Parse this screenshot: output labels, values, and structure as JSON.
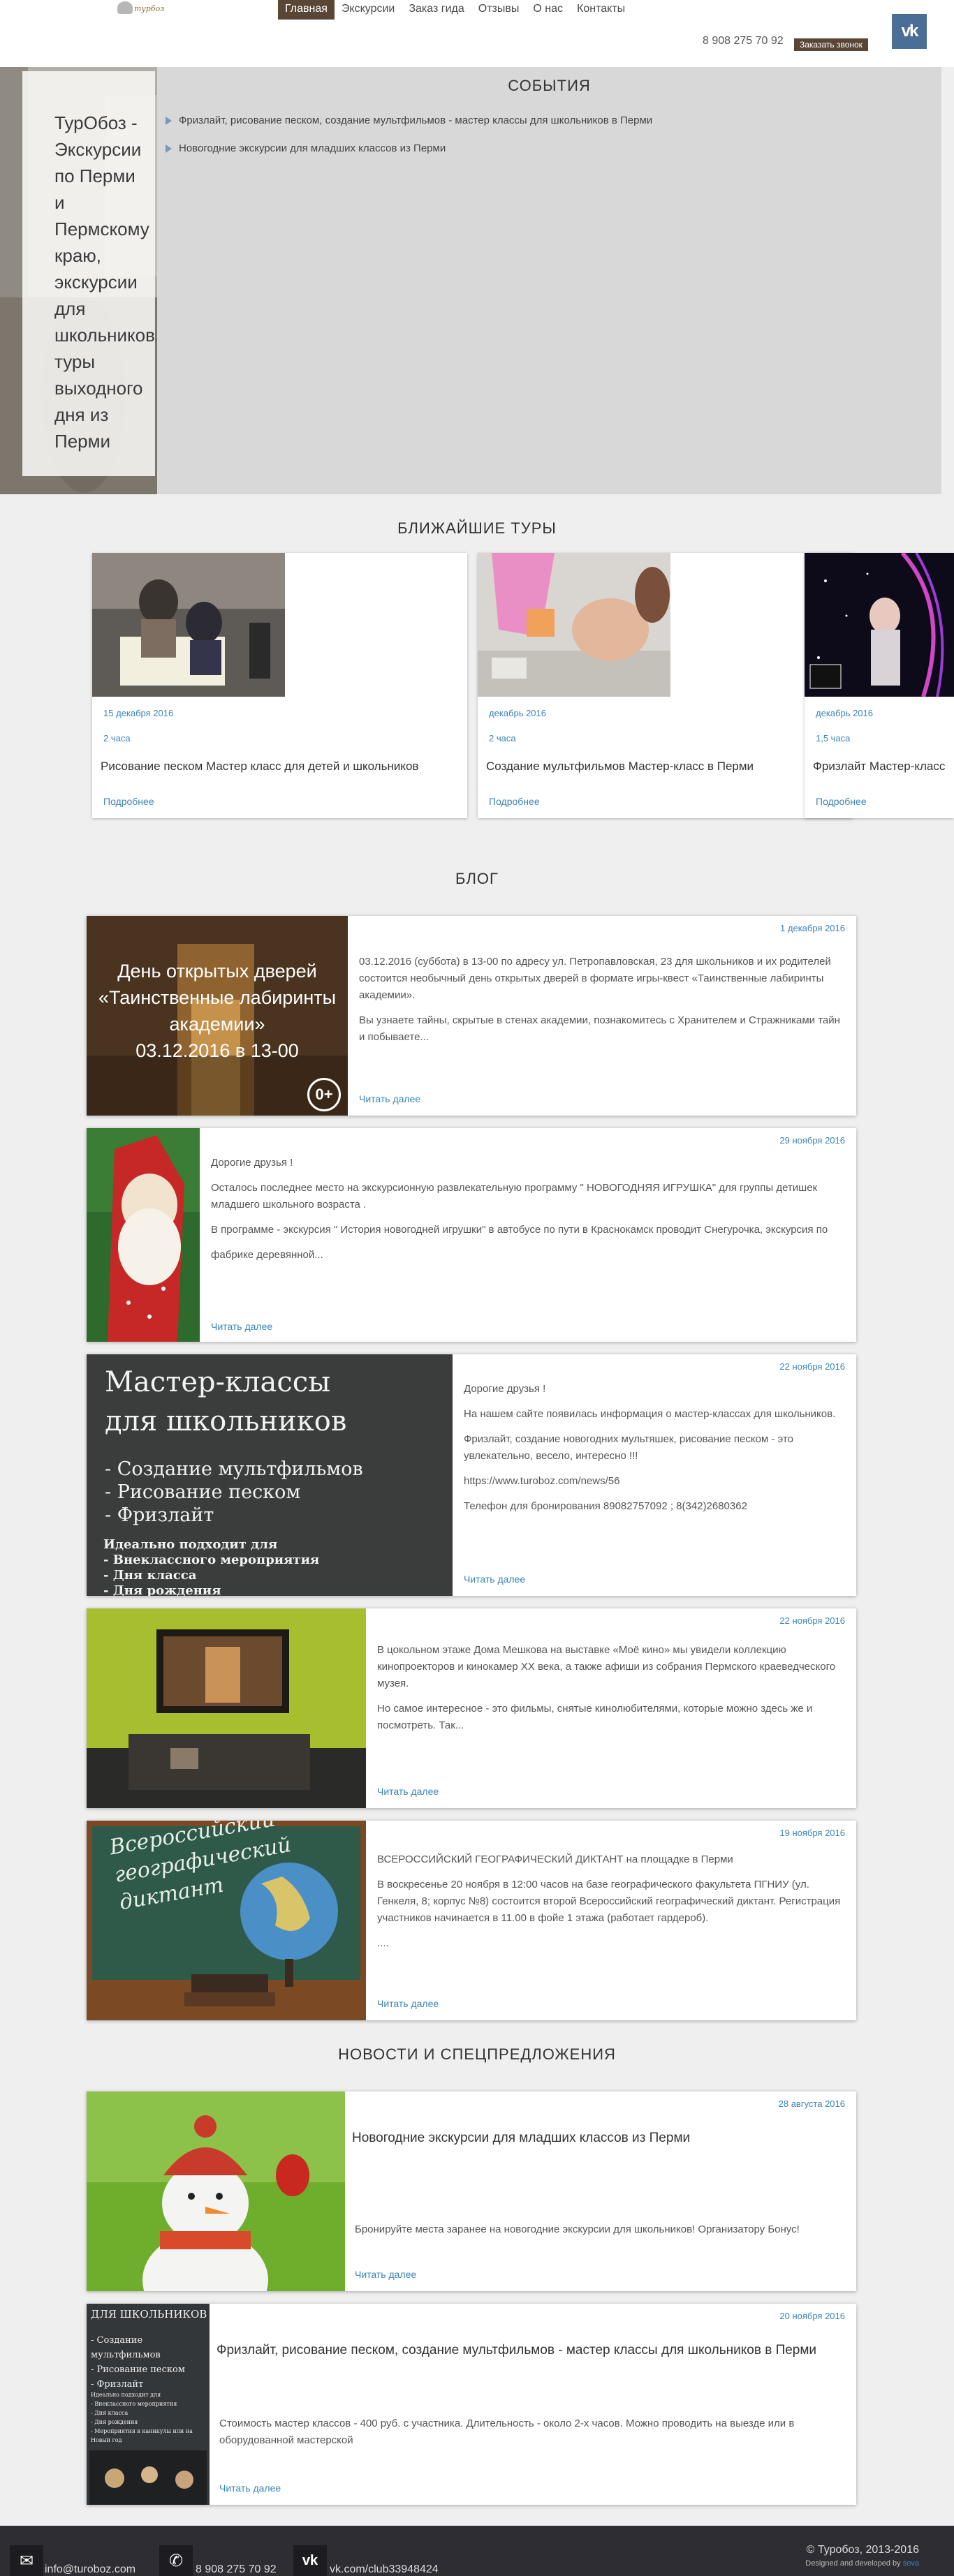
{
  "header": {
    "logo_text": "турбоз",
    "nav": [
      {
        "label": "Главная",
        "active": true
      },
      {
        "label": "Экскурсии",
        "active": false
      },
      {
        "label": "Заказ гида",
        "active": false
      },
      {
        "label": "Отзывы",
        "active": false
      },
      {
        "label": "О нас",
        "active": false
      },
      {
        "label": "Контакты",
        "active": false
      }
    ],
    "phone": "8 908 275 70 92",
    "callback_label": "Заказать звонок",
    "vk_label": "vk"
  },
  "hero": {
    "title": "ТурОбоз - Экскурсии по Перми и Пермскому краю, экскурсии для школьников, туры выходного дня из Перми",
    "events_title": "СОБЫТИЯ",
    "events": [
      "Фризлайт, рисование песком, создание мультфильмов - мастер классы для школьников в Перми",
      "Новогодние экскурсии для младших классов из Перми"
    ]
  },
  "tours": {
    "title": "БЛИЖАЙШИЕ ТУРЫ",
    "items": [
      {
        "date": "15 декабря 2016",
        "duration": "2 часа",
        "title": "Рисование песком Мастер класс для детей и школьников",
        "more": "Подробнее"
      },
      {
        "date": "декабрь 2016",
        "duration": "2 часа",
        "title": "Создание мультфильмов Мастер-класс в Перми",
        "more": "Подробнее"
      },
      {
        "date": "декабрь 2016",
        "duration": "1,5 часа",
        "title": "Фризлайт Мастер-класс",
        "more": "Подробнее"
      }
    ]
  },
  "blog": {
    "title": "БЛОГ",
    "posts": [
      {
        "date": "1 декабря 2016",
        "img_lines": [
          "День открытых дверей",
          "«Таинственные лабиринты",
          "академии»",
          "03.12.2016 в 13-00"
        ],
        "img_badge": "0+",
        "paragraphs": [
          "03.12.2016 (суббота) в 13-00 по адресу ул. Петропавловская, 23 для школьников и их родителей состоится необычный день открытых дверей в формате игры-квест «Таинственные лабиринты академии».",
          "Вы узнаете тайны, скрытые в стенах академии, познакомитесь с Хранителем и Стражниками тайн и побываете..."
        ],
        "more": "Читать далее"
      },
      {
        "date": "29 ноября 2016",
        "paragraphs": [
          "Дорогие друзья !",
          "Осталось последнее место на экскурсионную развлекательную программу \" НОВОГОДНЯЯ ИГРУШКА\" для группы детишек младшего школьного возраста .",
          "В программе - экскурсия \" История новогодней игрушки\" в автобусе по пути в Краснокамск проводит Снегурочка, экскурсия по",
          "фабрике деревянной..."
        ],
        "more": "Читать далее"
      },
      {
        "date": "22 ноября 2016",
        "img_title": [
          "Мастер-классы",
          "для школьников"
        ],
        "img_list": [
          "- Создание мультфильмов",
          "- Рисование песком",
          "- Фризлайт"
        ],
        "img_small": [
          "Идеально подходит для",
          "- Внеклассного мероприятия",
          "- Дня класса",
          "- Дня рождения"
        ],
        "paragraphs": [
          "Дорогие друзья !",
          "На нашем сайте появилась информация о мастер-классах для школьников.",
          "Фризлайт, создание новогодних мультяшек, рисование песком - это увлекательно, весело, интересно !!!",
          "https://www.turoboz.com/news/56",
          "Телефон для бронирования 89082757092 ; 8(342)2680362"
        ],
        "more": "Читать далее"
      },
      {
        "date": "22 ноября 2016",
        "paragraphs": [
          "В цокольном этаже Дома Мешкова на выставке «Моё кино» мы увидели коллекцию кинопроекторов и кинокамер XX века, а также афиши из собрания Пермского краеведческого музея.",
          "Но самое интересное - это фильмы, снятые кинолюбителями, которые можно здесь же и посмотреть. Так..."
        ],
        "more": "Читать далее"
      },
      {
        "date": "19 ноября 2016",
        "img_lines": [
          "Всероссийский",
          "географический",
          "диктант"
        ],
        "paragraphs": [
          "ВСЕРОССИЙСКИЙ ГЕОГРАФИЧЕСКИЙ ДИКТАНТ на площадке в Перми",
          "В воскресенье 20 ноября в 12:00 часов на базе географического факультета ПГНИУ (ул. Генкеля, 8; корпус №8) состоится второй Всероссийский географический диктант. Регистрация участников начинается в 11.00 в фойе 1 этажа (работает гардероб).",
          "...."
        ],
        "more": "Читать далее"
      }
    ]
  },
  "news": {
    "title": "НОВОСТИ И СПЕЦПРЕДЛОЖЕНИЯ",
    "items": [
      {
        "date": "28 августа 2016",
        "title": "Новогодние экскурсии для младших классов из Перми",
        "text": "Бронируйте места заранее на новогодние экскурсии для школьников! Организатору Бонус!",
        "more": "Читать далее"
      },
      {
        "date": "20 ноября 2016",
        "img_title": "ДЛЯ ШКОЛЬНИКОВ",
        "img_list": [
          "- Создание мультфильмов",
          "- Рисование песком",
          "- Фризлайт"
        ],
        "img_small": [
          "Идеально подходит для",
          "- Внеклассного мероприятия",
          "- Дня класса",
          "- Дня рождения",
          "- Мероприятия в каникулы или на Новый год"
        ],
        "title": "Фризлайт, рисование песком, создание мультфильмов - мастер классы для школьников в Перми",
        "text": "Стоимость мастер классов - 400 руб. с участника. Длительность - около 2-х часов. Можно проводить на выезде или в оборудованной мастерской",
        "more": "Читать далее"
      }
    ]
  },
  "footer": {
    "email": "info@turoboz.com",
    "phone": "8 908 275 70 92",
    "vk": "vk.com/club33948424",
    "copyright": "© Туробоз, 2013-2016",
    "developed_prefix": "Designed and developed by",
    "developed_by": "sova"
  },
  "colors": {
    "accent_brown": "#5a4636",
    "link_blue": "#3a84b8",
    "vk_blue": "#4a6f96",
    "footer_bg": "#2d2d33"
  }
}
